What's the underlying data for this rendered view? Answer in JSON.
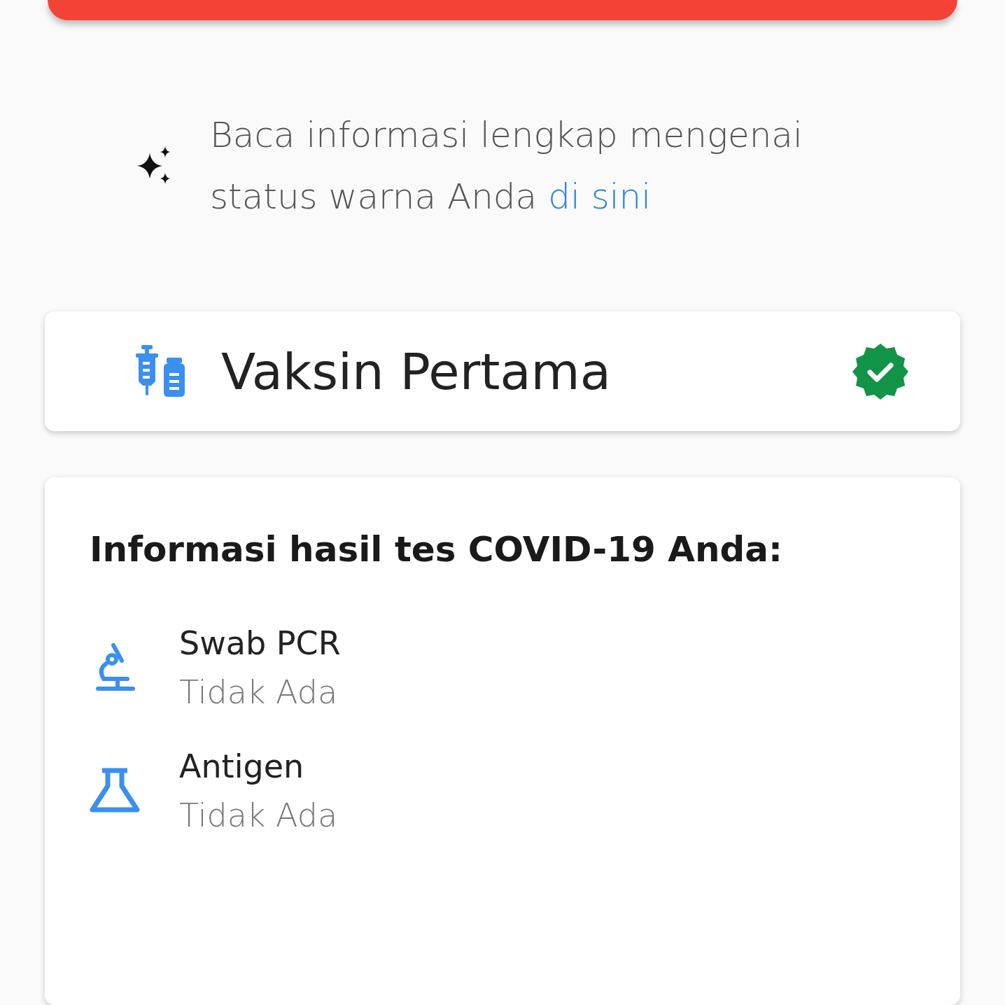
{
  "info": {
    "text": "Baca informasi lengkap mengenai status warna Anda ",
    "link": "di sini"
  },
  "vaccine": {
    "title": "Vaksin Pertama",
    "verified": true
  },
  "tests": {
    "title": "Informasi hasil tes COVID-19 Anda:",
    "items": [
      {
        "kind": "microscope",
        "name": "Swab PCR",
        "result": "Tidak Ada"
      },
      {
        "kind": "flask",
        "name": "Antigen",
        "result": "Tidak Ada"
      }
    ]
  }
}
